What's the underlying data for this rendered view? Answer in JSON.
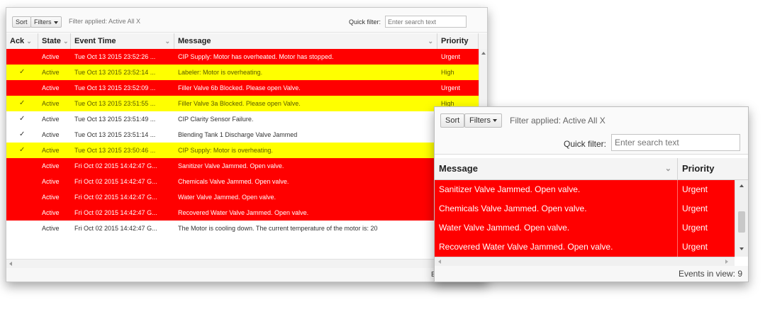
{
  "back": {
    "toolbar": {
      "sort_label": "Sort",
      "filters_label": "Filters",
      "filter_applied": "Filter applied: Active All X",
      "quick_filter_label": "Quick filter:",
      "quick_filter_placeholder": "Enter search text"
    },
    "columns": {
      "ack": "Ack",
      "state": "State",
      "event_time": "Event Time",
      "message": "Message",
      "priority": "Priority"
    },
    "rows": [
      {
        "ack": "",
        "state": "Active",
        "time": "Tue Oct 13 2015 23:52:26 ...",
        "message": "CIP Supply: Motor has overheated. Motor has stopped.",
        "priority": "Urgent",
        "level": "urgent"
      },
      {
        "ack": "✓",
        "state": "Active",
        "time": "Tue Oct 13 2015 23:52:14 ...",
        "message": "Labeler: Motor is overheating.",
        "priority": "High",
        "level": "high"
      },
      {
        "ack": "",
        "state": "Active",
        "time": "Tue Oct 13 2015 23:52:09 ...",
        "message": "Filler Valve 6b Blocked. Please open Valve.",
        "priority": "Urgent",
        "level": "urgent"
      },
      {
        "ack": "✓",
        "state": "Active",
        "time": "Tue Oct 13 2015 23:51:55 ...",
        "message": "Filler Valve 3a Blocked. Please open Valve.",
        "priority": "High",
        "level": "high"
      },
      {
        "ack": "✓",
        "state": "Active",
        "time": "Tue Oct 13 2015 23:51:49 ...",
        "message": "CIP Clarity Sensor Failure.",
        "priority": "",
        "level": "plain"
      },
      {
        "ack": "✓",
        "state": "Active",
        "time": "Tue Oct 13 2015 23:51:14 ...",
        "message": "Blending Tank 1 Discharge Valve Jammed",
        "priority": "",
        "level": "plain"
      },
      {
        "ack": "✓",
        "state": "Active",
        "time": "Tue Oct 13 2015 23:50:46 ...",
        "message": "CIP Supply: Motor is overheating.",
        "priority": "",
        "level": "high"
      },
      {
        "ack": "",
        "state": "Active",
        "time": "Fri Oct 02 2015 14:42:47 G...",
        "message": "Sanitizer Valve Jammed. Open valve.",
        "priority": "",
        "level": "urgent"
      },
      {
        "ack": "",
        "state": "Active",
        "time": "Fri Oct 02 2015 14:42:47 G...",
        "message": "Chemicals Valve Jammed. Open valve.",
        "priority": "",
        "level": "urgent"
      },
      {
        "ack": "",
        "state": "Active",
        "time": "Fri Oct 02 2015 14:42:47 G...",
        "message": "Water Valve Jammed. Open valve.",
        "priority": "",
        "level": "urgent"
      },
      {
        "ack": "",
        "state": "Active",
        "time": "Fri Oct 02 2015 14:42:47 G...",
        "message": "Recovered Water Valve Jammed. Open valve.",
        "priority": "",
        "level": "urgent"
      },
      {
        "ack": "",
        "state": "Active",
        "time": "Fri Oct 02 2015 14:42:47 G...",
        "message": "The Motor is cooling down. The current temperature of the motor is: 20",
        "priority": "",
        "level": "plain"
      }
    ],
    "footer_fragment": "E"
  },
  "front": {
    "toolbar": {
      "sort_label": "Sort",
      "filters_label": "Filters",
      "filter_applied": "Filter applied: Active All X",
      "quick_filter_label": "Quick filter:",
      "quick_filter_placeholder": "Enter search text"
    },
    "columns": {
      "message": "Message",
      "priority": "Priority"
    },
    "rows": [
      {
        "message": "Sanitizer Valve Jammed. Open valve.",
        "priority": "Urgent"
      },
      {
        "message": "Chemicals Valve Jammed. Open valve.",
        "priority": "Urgent"
      },
      {
        "message": "Water Valve Jammed. Open valve.",
        "priority": "Urgent"
      },
      {
        "message": "Recovered Water Valve Jammed. Open valve.",
        "priority": "Urgent"
      }
    ],
    "status": "Events in view: 9"
  },
  "colors": {
    "urgent": "#ff0000",
    "high": "#ffff00"
  }
}
